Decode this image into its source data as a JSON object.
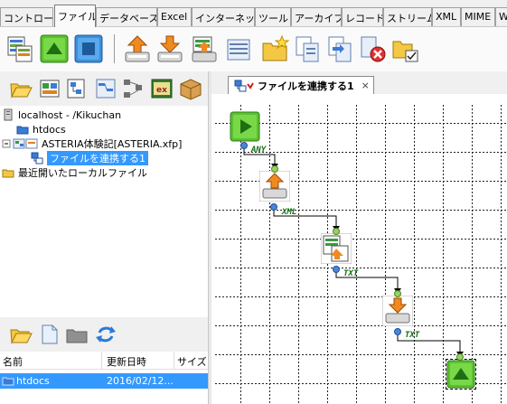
{
  "tabs": [
    "コントロール",
    "ファイル",
    "データベース",
    "Excel",
    "インターネット",
    "ツール",
    "アーカイブ",
    "レコード",
    "ストリーム",
    "XML",
    "MIME",
    "W"
  ],
  "active_tab": "ファイル",
  "tree": {
    "server": "localhost - /Kikuchan",
    "htdocs": "htdocs",
    "project": "ASTERIA体験記[ASTERIA.xfp]",
    "flow": "ファイルを連携する1",
    "recent": "最近開いたローカルファイル"
  },
  "filelist": {
    "headers": {
      "name": "名前",
      "date": "更新日時",
      "size": "サイズ"
    },
    "row": {
      "name": "htdocs",
      "date": "2016/02/12..."
    }
  },
  "editor": {
    "tab_title": "ファイルを連携する1",
    "close_glyph": "×",
    "port_types": [
      "ANY",
      "XML",
      "TXT",
      "TXT"
    ]
  },
  "colors": {
    "selection": "#3399ff",
    "port_out": "#4a86d8",
    "start_green": "#5cc030"
  }
}
